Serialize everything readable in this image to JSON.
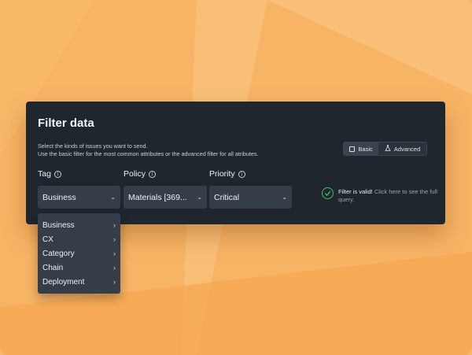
{
  "panel": {
    "title": "Filter data",
    "description_line1": "Select the kinds of issues you want to send.",
    "description_line2": "Use the basic filter for the most common attributes or the advanced filter for all atributes."
  },
  "mode_toggle": {
    "basic_label": "Basic",
    "advanced_label": "Advanced",
    "selected": "Basic"
  },
  "fields": {
    "tag": {
      "label": "Tag",
      "value": "Business"
    },
    "policy": {
      "label": "Policy",
      "value": "Materials [369..."
    },
    "priority": {
      "label": "Priority",
      "value": "Critical"
    }
  },
  "validation": {
    "status": "Filter is valid!",
    "hint": "Click here to see the full query."
  },
  "tag_dropdown": {
    "items": [
      {
        "label": "Business"
      },
      {
        "label": "CX"
      },
      {
        "label": "Category"
      },
      {
        "label": "Chain"
      },
      {
        "label": "Deployment"
      }
    ]
  },
  "colors": {
    "panel_bg": "#1f262e",
    "select_bg": "#353e48",
    "valid_green": "#3fbf6a",
    "background_orange": "#f7b96a"
  }
}
